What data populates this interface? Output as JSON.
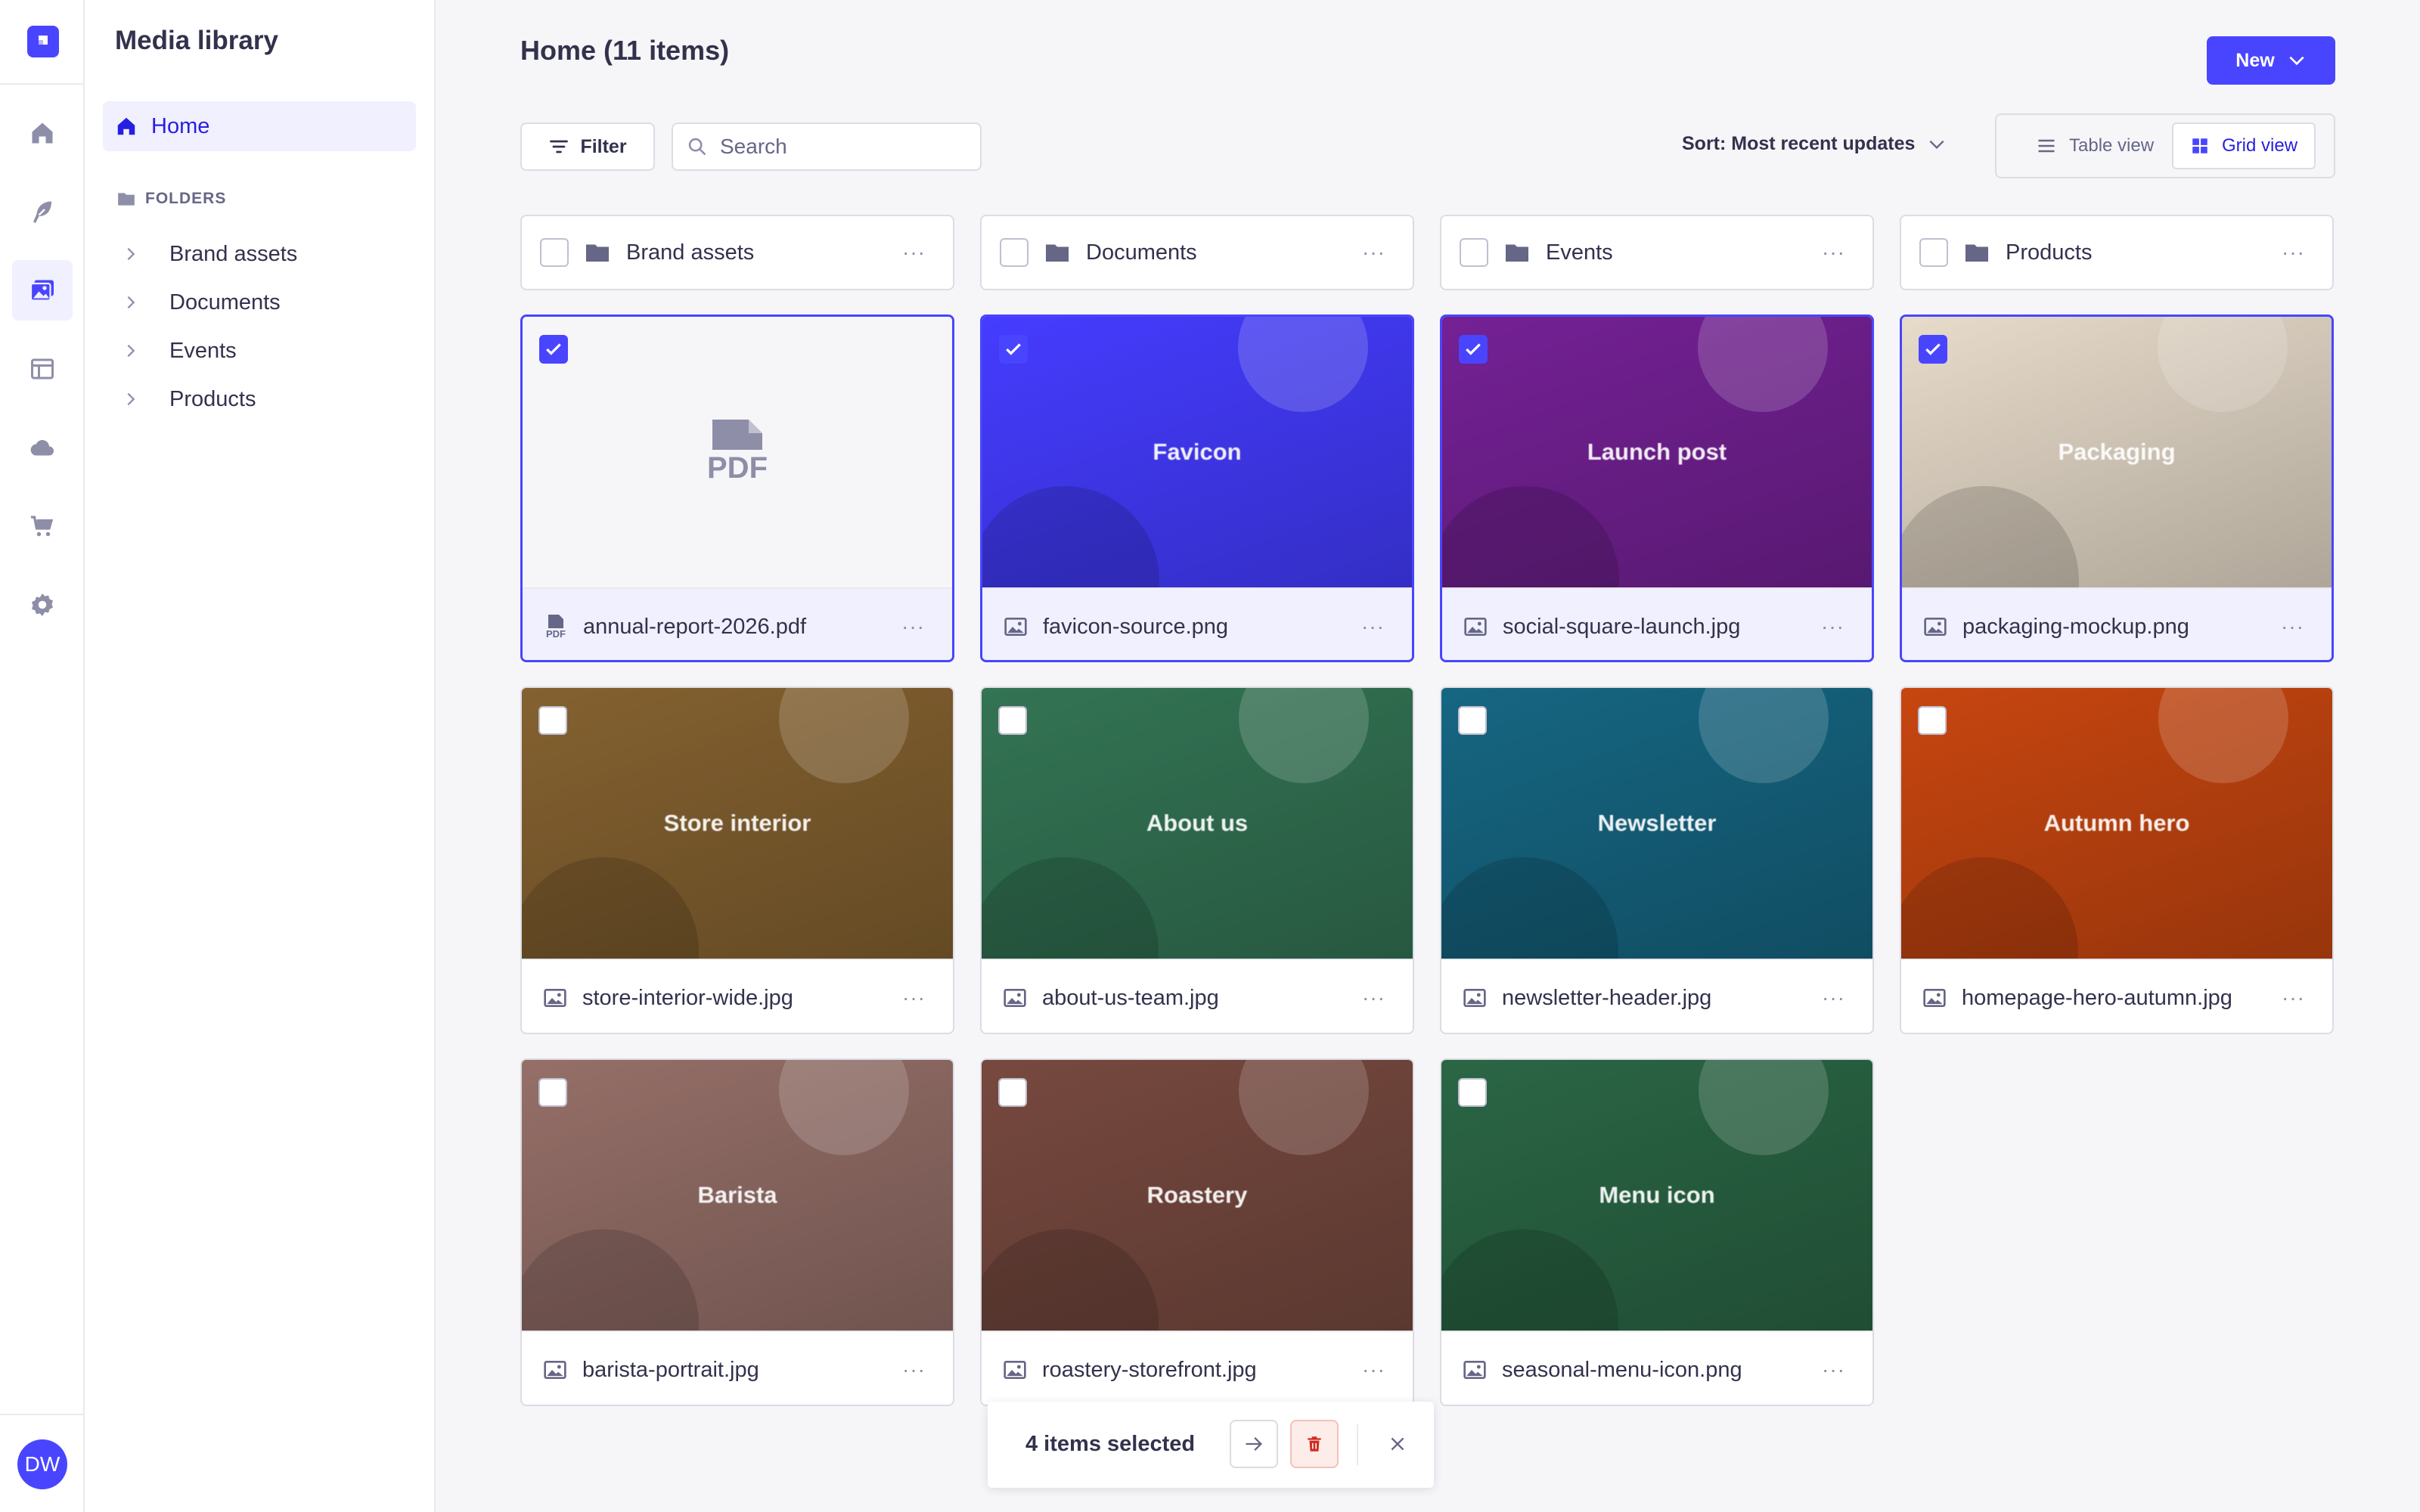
{
  "app": {
    "colors": {
      "accent": "#4945ff",
      "accent_text": "#271fe0",
      "danger": "#d02b20"
    },
    "user_initials": "DW",
    "rail_icons": [
      "home-icon",
      "feather-icon",
      "media-icon",
      "layout-icon",
      "cloud-icon",
      "cart-icon",
      "settings-icon"
    ]
  },
  "subnav": {
    "title": "Media library",
    "home_label": "Home",
    "folders_heading": "FOLDERS",
    "folders": [
      "Brand assets",
      "Documents",
      "Events",
      "Products"
    ]
  },
  "header": {
    "title": "Home (11 items)",
    "new_label": "New"
  },
  "toolbar": {
    "filter_label": "Filter",
    "search_placeholder": "Search",
    "sort_label": "Sort: Most recent updates",
    "table_view_label": "Table view",
    "grid_view_label": "Grid view",
    "active_view": "grid"
  },
  "folder_cards": [
    {
      "name": "Brand assets",
      "more": "···"
    },
    {
      "name": "Documents",
      "more": "···"
    },
    {
      "name": "Events",
      "more": "···"
    },
    {
      "name": "Products",
      "more": "···"
    }
  ],
  "assets": [
    {
      "file": "annual-report-2026.pdf",
      "caption": "",
      "selected": true,
      "kind": "pdf",
      "badge": "PDF",
      "icon_badge": "PDF",
      "more": "···"
    },
    {
      "file": "favicon-source.png",
      "caption": "Favicon",
      "selected": true,
      "kind": "image",
      "color": "#4038f0",
      "more": "···"
    },
    {
      "file": "social-square-launch.jpg",
      "caption": "Launch post",
      "selected": true,
      "kind": "image",
      "color": "#6b1f8a",
      "more": "···"
    },
    {
      "file": "packaging-mockup.png",
      "caption": "Packaging",
      "selected": true,
      "kind": "image",
      "color": "#d6cbbb",
      "more": "···"
    },
    {
      "file": "store-interior-wide.jpg",
      "caption": "Store interior",
      "selected": false,
      "kind": "image",
      "color": "#7a5a2c",
      "more": "···"
    },
    {
      "file": "about-us-team.jpg",
      "caption": "About us",
      "selected": false,
      "kind": "image",
      "color": "#2f6b4e",
      "more": "···"
    },
    {
      "file": "newsletter-header.jpg",
      "caption": "Newsletter",
      "selected": false,
      "kind": "image",
      "color": "#145e78",
      "more": "···"
    },
    {
      "file": "homepage-hero-autumn.jpg",
      "caption": "Autumn hero",
      "selected": false,
      "kind": "image",
      "color": "#b8410f",
      "more": "···"
    },
    {
      "file": "barista-portrait.jpg",
      "caption": "Barista",
      "selected": false,
      "kind": "image",
      "color": "#8a6760",
      "more": "···"
    },
    {
      "file": "roastery-storefront.jpg",
      "caption": "Roastery",
      "selected": false,
      "kind": "image",
      "color": "#6e443a",
      "more": "···"
    },
    {
      "file": "seasonal-menu-icon.png",
      "caption": "Menu icon",
      "selected": false,
      "kind": "image",
      "color": "#275e40",
      "more": "···"
    }
  ],
  "selection_bar": {
    "count_label": "4 items selected"
  }
}
